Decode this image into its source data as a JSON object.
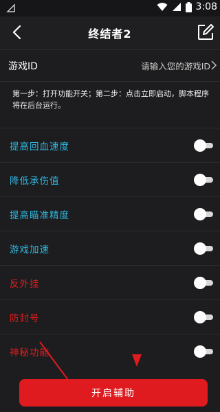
{
  "status_bar": {
    "time": "3:08",
    "icons": [
      "wifi-icon",
      "signal-icon",
      "battery-icon"
    ]
  },
  "header": {
    "title": "终结者2",
    "back_icon": "back-arrow-icon",
    "edit_icon": "edit-icon"
  },
  "game_id": {
    "label": "游戏ID",
    "placeholder": "请输入您的游戏ID",
    "value": ""
  },
  "instructions": "第一步：打开功能开关；第二步：点击立即启动，脚本程序将在后台运行。",
  "features": [
    {
      "label": "提高回血速度",
      "color": "#2fb7e0",
      "enabled": false
    },
    {
      "label": "降低承伤值",
      "color": "#2fb7e0",
      "enabled": false
    },
    {
      "label": "提高瞄准精度",
      "color": "#2fb7e0",
      "enabled": false
    },
    {
      "label": "游戏加速",
      "color": "#2fb7e0",
      "enabled": false
    },
    {
      "label": "反外挂",
      "color": "#e01c1c",
      "enabled": false
    },
    {
      "label": "防封号",
      "color": "#e01c1c",
      "enabled": false
    },
    {
      "label": "神秘功能",
      "color": "#e01c1c",
      "enabled": false
    }
  ],
  "action": {
    "start_label": "开启辅助",
    "color": "#e01b1f"
  }
}
